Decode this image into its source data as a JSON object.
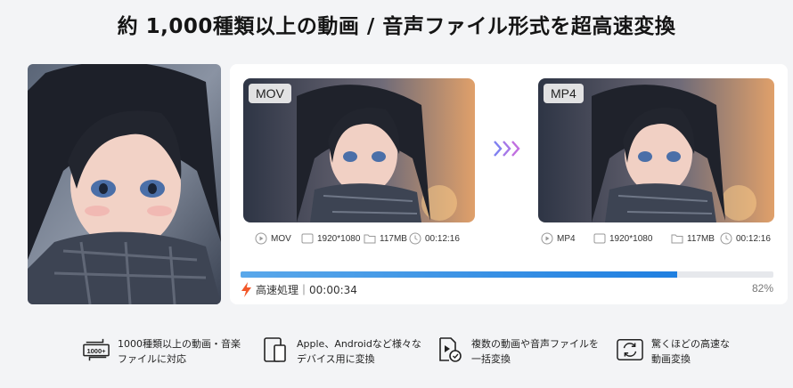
{
  "headline": "約 1,000種類以上の動画 / 音声ファイル形式を超高速変換",
  "conversion": {
    "source": {
      "format_tag": "MOV",
      "format": "MOV",
      "resolution": "1920*1080",
      "size": "117MB",
      "duration": "00:12:16"
    },
    "target": {
      "format_tag": "MP4",
      "format": "MP4",
      "resolution": "1920*1080",
      "size": "117MB",
      "duration": "00:12:16"
    },
    "progress": {
      "percent": 82,
      "percent_label": "82%",
      "status": "高速処理｜00:00:34"
    }
  },
  "features": [
    {
      "icon": "1000plus-formats-icon",
      "icon_text": "1000+",
      "line1": "1000種類以上の動画・音楽",
      "line2": "ファイルに対応"
    },
    {
      "icon": "devices-icon",
      "line1": "Apple、Androidなど様々な",
      "line2": "デバイス用に変換"
    },
    {
      "icon": "batch-convert-icon",
      "line1": "複数の動画や音声ファイルを",
      "line2": "一括変換"
    },
    {
      "icon": "fast-convert-icon",
      "line1": "驚くほどの高速な",
      "line2": "動画変換"
    }
  ],
  "colors": {
    "progress": "#2a87e4",
    "bolt": "#f2582a",
    "arrows": "#8b6cf0",
    "background": "#f3f4f6"
  }
}
